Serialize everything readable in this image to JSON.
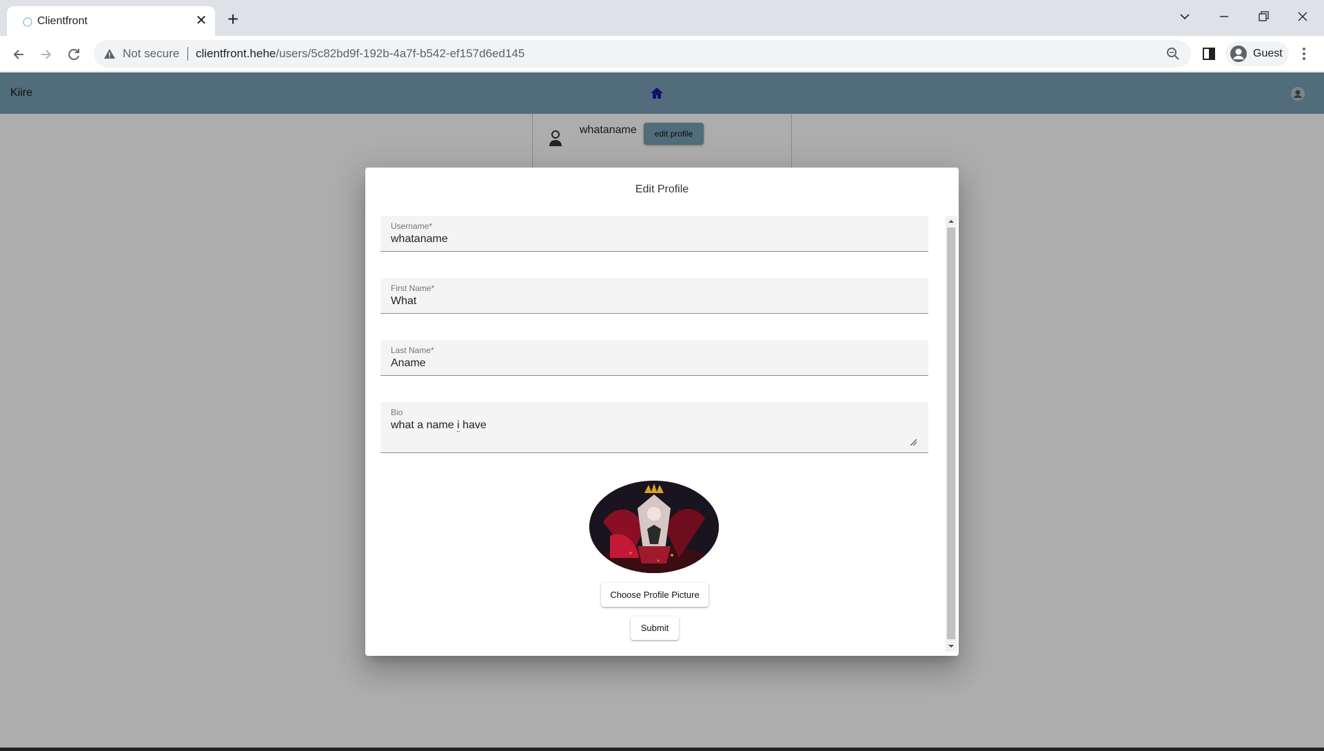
{
  "browser": {
    "tab_title": "Clientfront",
    "new_tab_icon": "plus-icon",
    "window_controls": [
      "tab-search-chevron",
      "minimize",
      "restore",
      "close"
    ],
    "security_label": "Not secure",
    "url_host": "clientfront.hehe",
    "url_path": "/users/5c82bd9f-192b-4a7f-b542-ef157d6ed145",
    "profile_label": "Guest"
  },
  "appbar": {
    "brand": "Kiire",
    "color": "#78a0b4",
    "home_icon": "home-icon",
    "account_icon": "account-icon"
  },
  "profile_card": {
    "username": "whataname",
    "edit_button": "edit profile"
  },
  "dialog": {
    "title": "Edit Profile",
    "fields": {
      "username": {
        "label": "Username*",
        "value": "whataname"
      },
      "first_name": {
        "label": "First Name*",
        "value": "What"
      },
      "last_name": {
        "label": "Last Name*",
        "value": "Aname"
      },
      "bio": {
        "label": "Bio",
        "value_before": "what a name ",
        "value_misspelled": "i",
        "value_after": " have"
      }
    },
    "choose_picture_button": "Choose Profile Picture",
    "submit_button": "Submit"
  }
}
